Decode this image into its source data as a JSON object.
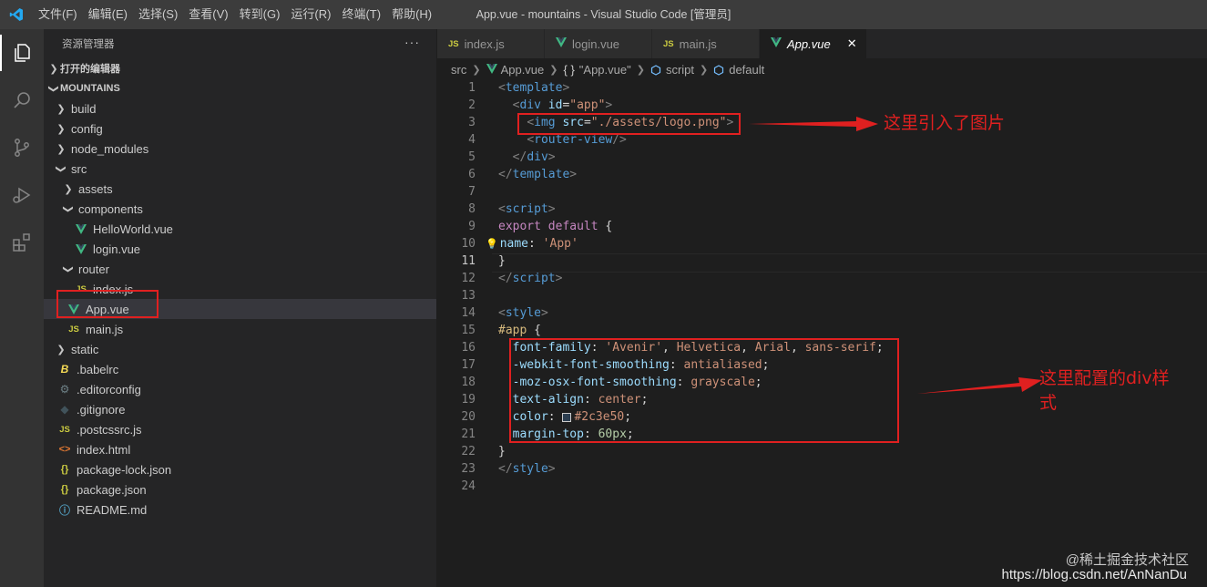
{
  "window": {
    "title": "App.vue - mountains - Visual Studio Code [管理员]",
    "menu": [
      "文件(F)",
      "编辑(E)",
      "选择(S)",
      "查看(V)",
      "转到(G)",
      "运行(R)",
      "终端(T)",
      "帮助(H)"
    ]
  },
  "activity_bar": [
    "explorer-icon",
    "search-icon",
    "source-control-icon",
    "run-debug-icon",
    "extensions-icon"
  ],
  "sidebar": {
    "title": "资源管理器",
    "more": "···",
    "open_editors": "打开的编辑器",
    "project": "MOUNTAINS",
    "tree": [
      {
        "label": "build",
        "type": "folder",
        "open": false,
        "indent": 0
      },
      {
        "label": "config",
        "type": "folder",
        "open": false,
        "indent": 0
      },
      {
        "label": "node_modules",
        "type": "folder",
        "open": false,
        "indent": 0
      },
      {
        "label": "src",
        "type": "folder",
        "open": true,
        "indent": 0
      },
      {
        "label": "assets",
        "type": "folder",
        "open": false,
        "indent": 1
      },
      {
        "label": "components",
        "type": "folder",
        "open": true,
        "indent": 1
      },
      {
        "label": "HelloWorld.vue",
        "type": "vue",
        "indent": 2
      },
      {
        "label": "login.vue",
        "type": "vue",
        "indent": 2
      },
      {
        "label": "router",
        "type": "folder",
        "open": true,
        "indent": 1
      },
      {
        "label": "index.js",
        "type": "js",
        "indent": 2
      },
      {
        "label": "App.vue",
        "type": "vue",
        "indent": 1,
        "selected": true
      },
      {
        "label": "main.js",
        "type": "js",
        "indent": 1
      },
      {
        "label": "static",
        "type": "folder",
        "open": false,
        "indent": 0
      },
      {
        "label": ".babelrc",
        "type": "babel",
        "indent": 0
      },
      {
        "label": ".editorconfig",
        "type": "gear",
        "indent": 0
      },
      {
        "label": ".gitignore",
        "type": "git",
        "indent": 0
      },
      {
        "label": ".postcssrc.js",
        "type": "js",
        "indent": 0
      },
      {
        "label": "index.html",
        "type": "html",
        "indent": 0
      },
      {
        "label": "package-lock.json",
        "type": "json",
        "indent": 0
      },
      {
        "label": "package.json",
        "type": "json",
        "indent": 0
      },
      {
        "label": "README.md",
        "type": "info",
        "indent": 0
      }
    ]
  },
  "tabs": [
    {
      "label": "index.js",
      "icon": "JS"
    },
    {
      "label": "login.vue",
      "icon": "V"
    },
    {
      "label": "main.js",
      "icon": "JS"
    },
    {
      "label": "App.vue",
      "icon": "V",
      "active": true,
      "close": "✕"
    }
  ],
  "breadcrumb": [
    "src",
    "App.vue",
    "\"App.vue\"",
    "script",
    "default"
  ],
  "code": {
    "current_line": 11,
    "lines": [
      [
        [
          "t-br",
          "<"
        ],
        [
          "t-tag",
          "template"
        ],
        [
          "t-br",
          ">"
        ]
      ],
      [
        [
          "",
          "  "
        ],
        [
          "t-br",
          "<"
        ],
        [
          "t-tag",
          "div"
        ],
        [
          "",
          ""
        ],
        [
          "t-attr",
          " id"
        ],
        [
          "",
          "="
        ],
        [
          "t-str",
          "\"app\""
        ],
        [
          "t-br",
          ">"
        ]
      ],
      [
        [
          "",
          "    "
        ],
        [
          "t-br",
          "<"
        ],
        [
          "t-tag",
          "img"
        ],
        [
          "t-attr",
          " src"
        ],
        [
          "",
          "="
        ],
        [
          "t-str",
          "\"./assets/logo.png\""
        ],
        [
          "t-br",
          ">"
        ]
      ],
      [
        [
          "",
          "    "
        ],
        [
          "t-br",
          "<"
        ],
        [
          "t-tag",
          "router-view"
        ],
        [
          "t-br",
          "/>"
        ]
      ],
      [
        [
          "",
          "  "
        ],
        [
          "t-br",
          "</"
        ],
        [
          "t-tag",
          "div"
        ],
        [
          "t-br",
          ">"
        ]
      ],
      [
        [
          "t-br",
          "</"
        ],
        [
          "t-tag",
          "template"
        ],
        [
          "t-br",
          ">"
        ]
      ],
      [],
      [
        [
          "t-br",
          "<"
        ],
        [
          "t-tag",
          "script"
        ],
        [
          "t-br",
          ">"
        ]
      ],
      [
        [
          "t-kw",
          "export"
        ],
        [
          "",
          " "
        ],
        [
          "t-kw",
          "default"
        ],
        [
          "",
          " {"
        ]
      ],
      [
        [
          "",
          "💡"
        ],
        [
          "t-prop",
          "name"
        ],
        [
          "",
          ": "
        ],
        [
          "t-str",
          "'App'"
        ]
      ],
      [
        [
          "",
          "}"
        ]
      ],
      [
        [
          "t-br",
          "</"
        ],
        [
          "t-tag",
          "script"
        ],
        [
          "t-br",
          ">"
        ]
      ],
      [],
      [
        [
          "t-br",
          "<"
        ],
        [
          "t-tag",
          "style"
        ],
        [
          "t-br",
          ">"
        ]
      ],
      [
        [
          "t-sel",
          "#app"
        ],
        [
          "",
          " {"
        ]
      ],
      [
        [
          "",
          "  "
        ],
        [
          "t-prop",
          "font-family"
        ],
        [
          "",
          ": "
        ],
        [
          "t-val",
          "'Avenir'"
        ],
        [
          "",
          ", "
        ],
        [
          "t-val",
          "Helvetica"
        ],
        [
          "",
          ", "
        ],
        [
          "t-val",
          "Arial"
        ],
        [
          "",
          ", "
        ],
        [
          "t-val",
          "sans-serif"
        ],
        [
          "",
          ";"
        ]
      ],
      [
        [
          "",
          "  "
        ],
        [
          "t-prop",
          "-webkit-font-smoothing"
        ],
        [
          "",
          ": "
        ],
        [
          "t-val",
          "antialiased"
        ],
        [
          "",
          ";"
        ]
      ],
      [
        [
          "",
          "  "
        ],
        [
          "t-prop",
          "-moz-osx-font-smoothing"
        ],
        [
          "",
          ": "
        ],
        [
          "t-val",
          "grayscale"
        ],
        [
          "",
          ";"
        ]
      ],
      [
        [
          "",
          "  "
        ],
        [
          "t-prop",
          "text-align"
        ],
        [
          "",
          ": "
        ],
        [
          "t-val",
          "center"
        ],
        [
          "",
          ";"
        ]
      ],
      [
        [
          "",
          "  "
        ],
        [
          "t-prop",
          "color"
        ],
        [
          "",
          ": "
        ],
        [
          "",
          "□"
        ],
        [
          "t-val",
          "#2c3e50"
        ],
        [
          "",
          ";"
        ]
      ],
      [
        [
          "",
          "  "
        ],
        [
          "t-prop",
          "margin-top"
        ],
        [
          "",
          ": "
        ],
        [
          "t-num",
          "60px"
        ],
        [
          "",
          ";"
        ]
      ],
      [
        [
          "",
          "}"
        ]
      ],
      [
        [
          "t-br",
          "</"
        ],
        [
          "t-tag",
          "style"
        ],
        [
          "t-br",
          ">"
        ]
      ],
      []
    ]
  },
  "annotations": {
    "img_note": "这里引入了图片",
    "style_note_line1": "这里配置的div样",
    "style_note_line2": "式",
    "color": "#e02020"
  },
  "watermark": {
    "line1": "@稀土掘金技术社区",
    "line2": "https://blog.csdn.net/AnNanDu"
  }
}
